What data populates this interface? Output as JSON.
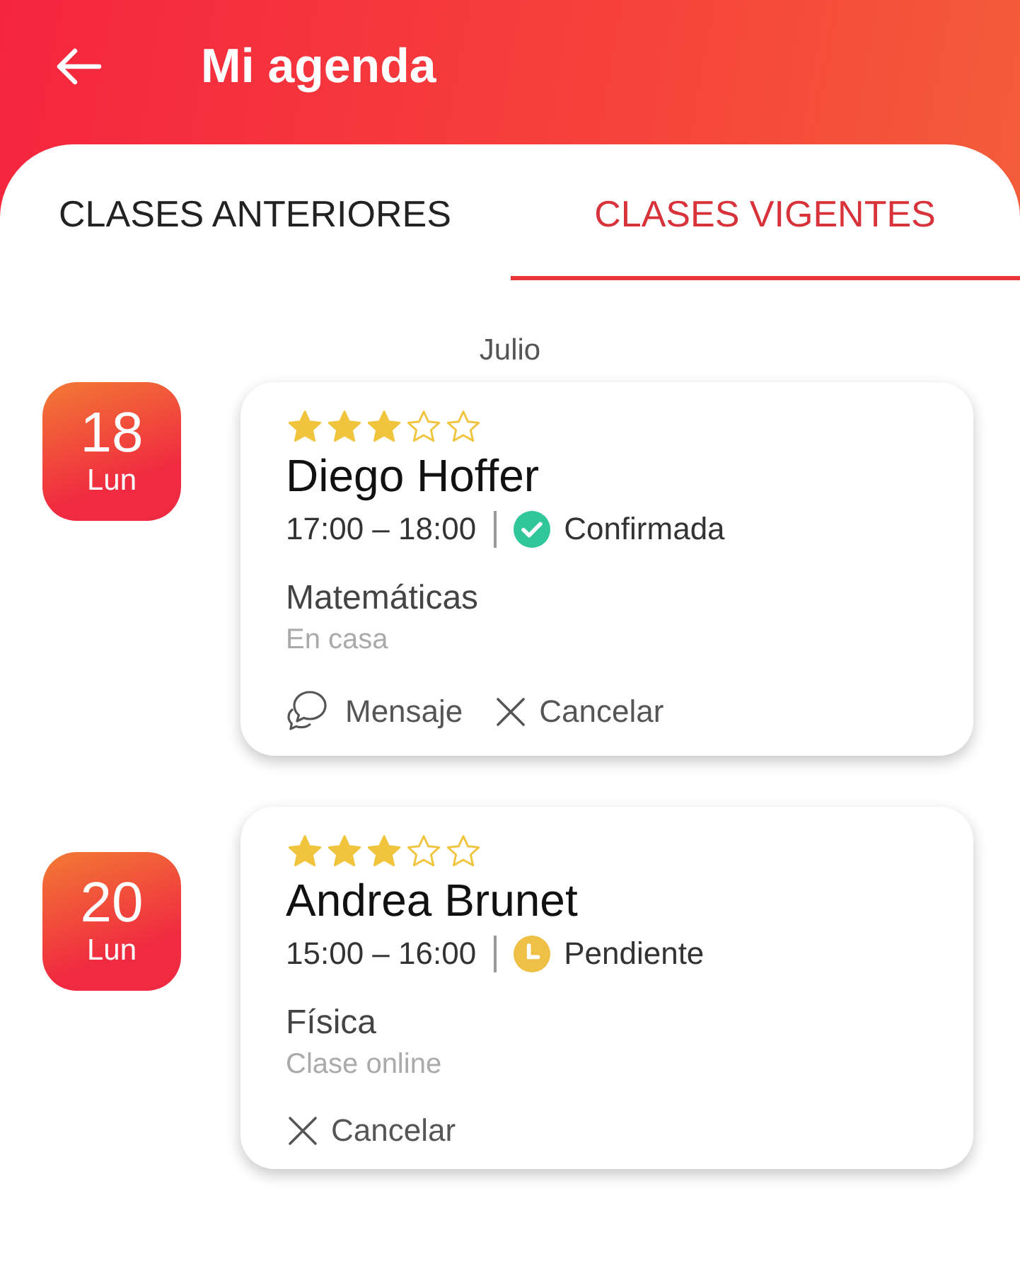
{
  "header": {
    "title": "Mi agenda"
  },
  "tabs": [
    {
      "label": "CLASES ANTERIORES",
      "selected": false
    },
    {
      "label": "CLASES VIGENTES",
      "selected": true
    }
  ],
  "month": "Julio",
  "classes": [
    {
      "day": "18",
      "weekday": "Lun",
      "stars": 3,
      "teacher": "Diego Hoffer",
      "time": "17:00 – 18:00",
      "status": {
        "kind": "confirmed",
        "label": "Confirmada"
      },
      "subject": "Matemáticas",
      "place": "En casa",
      "actions": [
        {
          "kind": "message",
          "label": "Mensaje"
        },
        {
          "kind": "cancel",
          "label": "Cancelar"
        }
      ]
    },
    {
      "day": "20",
      "weekday": "Lun",
      "stars": 3,
      "teacher": "Andrea Brunet",
      "time": "15:00 – 16:00",
      "status": {
        "kind": "pending",
        "label": "Pendiente"
      },
      "subject": "Física",
      "place": "Clase online",
      "actions": [
        {
          "kind": "cancel",
          "label": "Cancelar"
        }
      ]
    }
  ]
}
